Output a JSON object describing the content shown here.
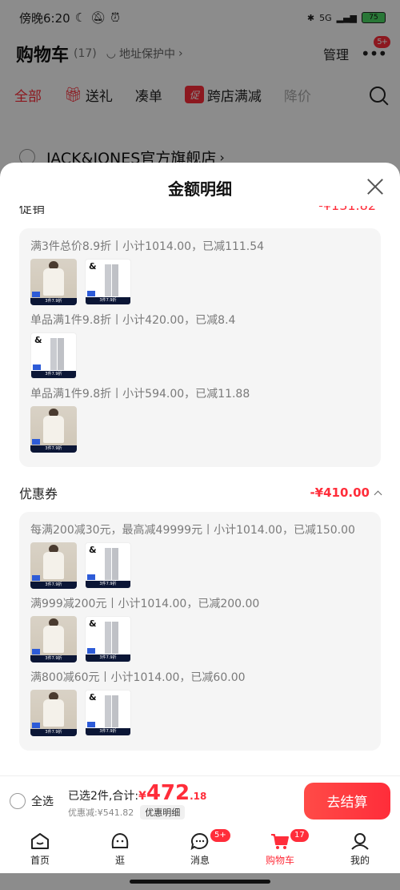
{
  "status": {
    "time": "傍晚6:20",
    "network": "5G",
    "battery": "75"
  },
  "header": {
    "title": "购物车",
    "count": "(17)",
    "address_protect": "地址保护中",
    "manage": "管理",
    "more_badge": "5+"
  },
  "tabs": [
    {
      "label": "全部"
    },
    {
      "label": "送礼"
    },
    {
      "label": "凑单"
    },
    {
      "label": "跨店满减",
      "icon": "促"
    },
    {
      "label": "降价"
    }
  ],
  "store": {
    "name": "JACK&JONES官方旗舰店"
  },
  "sheet": {
    "title": "金额明细",
    "promo_groups": [
      {
        "rule": "满3件总价8.9折丨小计1014.00，已减111.54",
        "items": [
          "jacket",
          "pants"
        ]
      },
      {
        "rule": "单品满1件9.8折丨小计420.00，已减8.4",
        "items": [
          "pants"
        ]
      },
      {
        "rule": "单品满1件9.8折丨小计594.00，已减11.88",
        "items": [
          "jacket"
        ]
      }
    ],
    "coupon_title": "优惠券",
    "coupon_amount": "-¥410.00",
    "coupon_groups": [
      {
        "rule": "每满200减30元，最高减49999元丨小计1014.00，已减150.00",
        "items": [
          "jacket",
          "pants"
        ]
      },
      {
        "rule": "满999减200元丨小计1014.00，已减200.00",
        "items": [
          "jacket",
          "pants"
        ]
      },
      {
        "rule": "满800减60元丨小计1014.00，已减60.00",
        "items": [
          "jacket",
          "pants"
        ]
      }
    ]
  },
  "checkout": {
    "select_all": "全选",
    "selected_text": "已选2件,合计:",
    "currency": "¥",
    "total_int": "472",
    "total_dec": ".18",
    "discount": "优惠减:¥541.82",
    "detail_chip": "优惠明细",
    "button": "去结算"
  },
  "tabbar": [
    {
      "label": "首页",
      "icon": "home-icon"
    },
    {
      "label": "逛",
      "icon": "face-icon"
    },
    {
      "label": "消息",
      "icon": "message-icon",
      "badge": "5+"
    },
    {
      "label": "购物车",
      "icon": "cart-icon",
      "badge": "17",
      "active": true
    },
    {
      "label": "我的",
      "icon": "user-icon"
    }
  ],
  "colors": {
    "accent": "#ff2d3a",
    "overlay": "rgba(0,0,0,0.45)"
  }
}
